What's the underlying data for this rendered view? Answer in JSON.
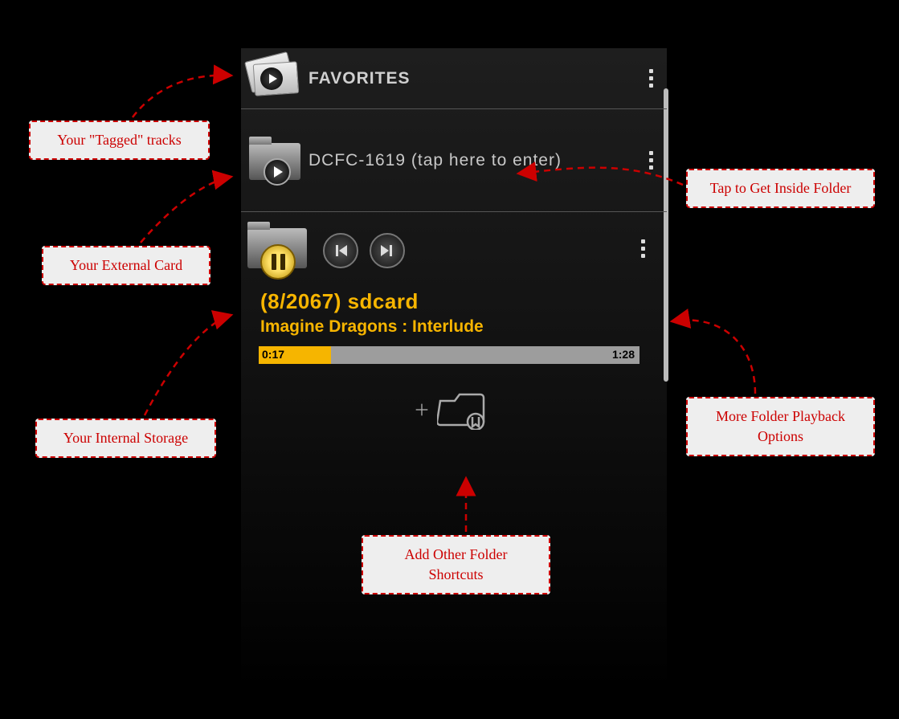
{
  "rows": {
    "favorites": {
      "label": "FAVORITES"
    },
    "dcfc": {
      "label": "DCFC-1619 (tap here to enter)"
    }
  },
  "now_playing": {
    "counter_prefix": "(",
    "counter": "8/2067",
    "counter_suffix": ")  ",
    "folder": "sdcard",
    "track": "Imagine Dragons : Interlude",
    "time_elapsed": "0:17",
    "time_total": "1:28",
    "progress_percent": 19
  },
  "annotations": {
    "tagged": "Your \"Tagged\" tracks",
    "external": "Your External Card",
    "internal": "Your Internal Storage",
    "tap_inside": "Tap to Get Inside Folder",
    "more_options": "More Folder Playback Options",
    "add_shortcut": "Add Other Folder Shortcuts"
  }
}
